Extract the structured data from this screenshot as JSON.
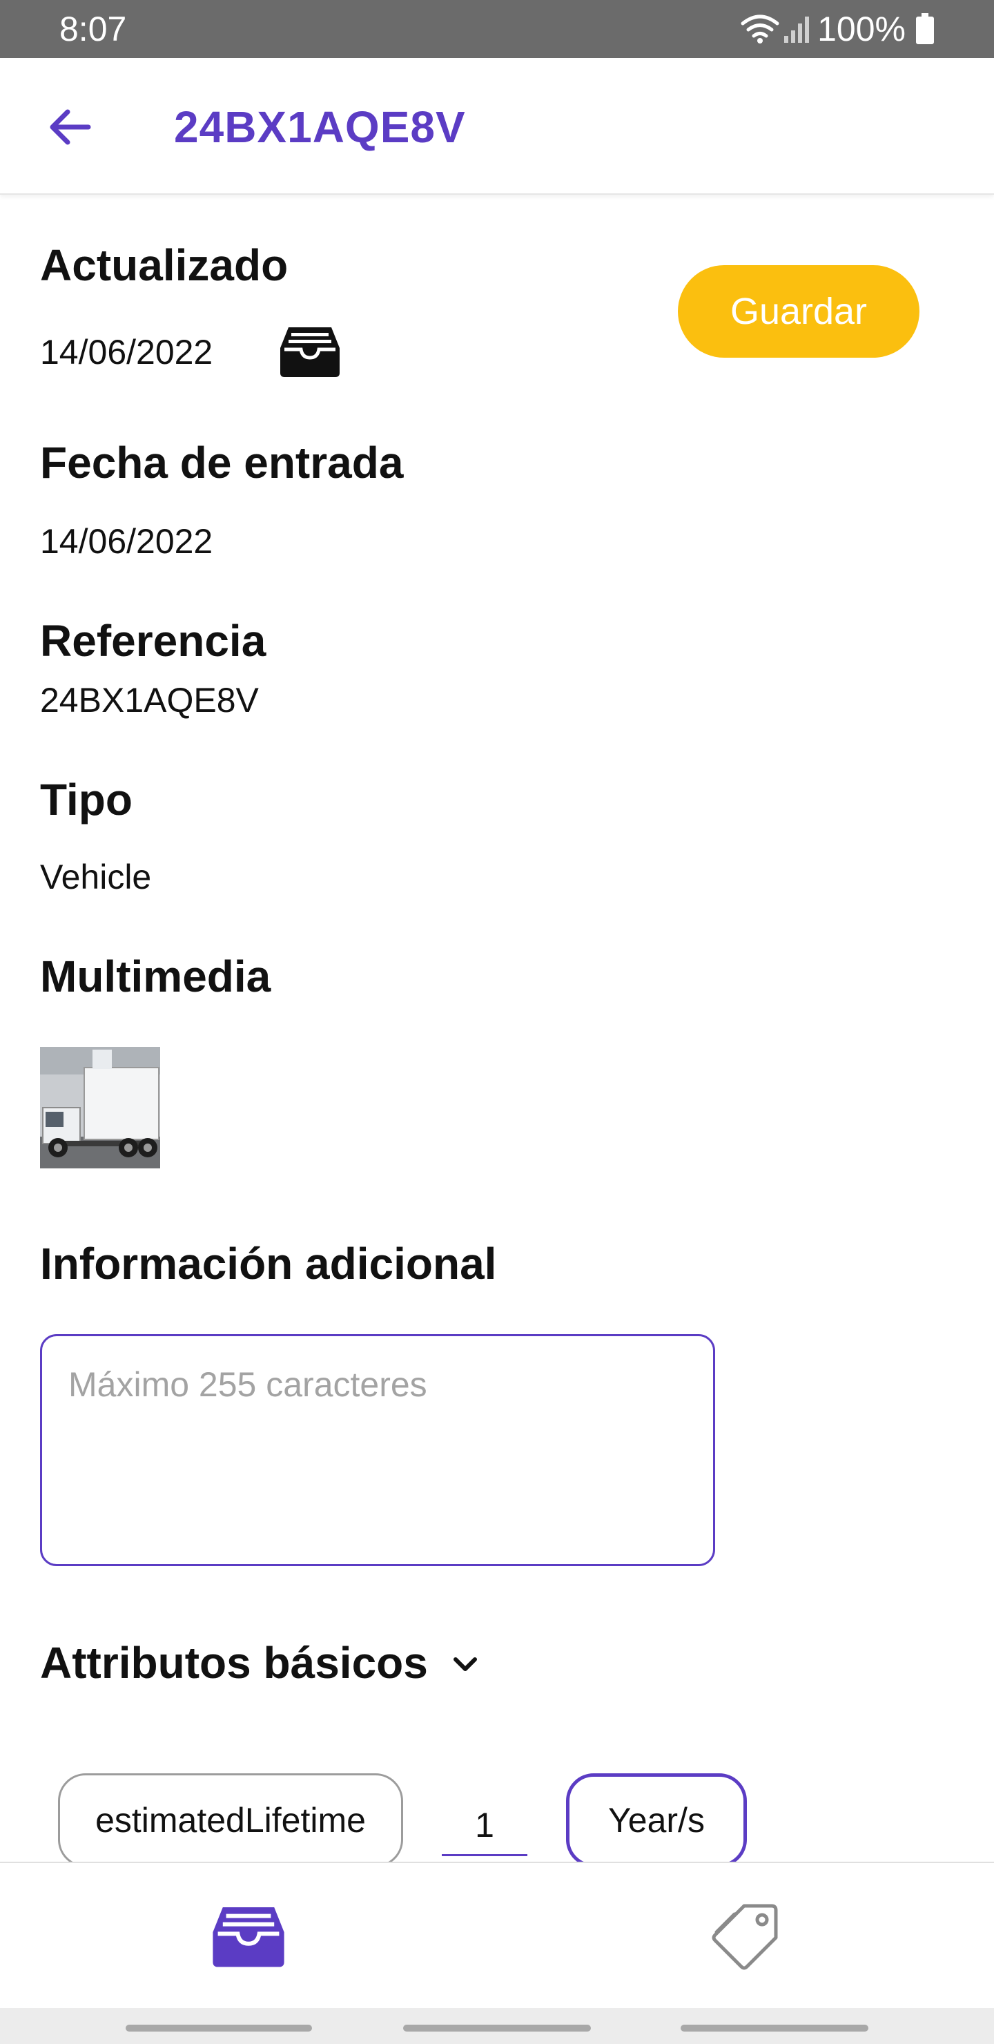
{
  "status_bar": {
    "time": "8:07",
    "battery": "100%",
    "icons": [
      "wifi-icon",
      "signal-icon",
      "battery-icon"
    ]
  },
  "app_bar": {
    "back_icon": "arrow-left-icon",
    "title": "24BX1AQE8V"
  },
  "actions": {
    "save_label": "Guardar"
  },
  "fields": {
    "updated_label": "Actualizado",
    "updated_value": "14/06/2022",
    "archive_icon": "archive-tray-icon",
    "entry_date_label": "Fecha de entrada",
    "entry_date_value": "14/06/2022",
    "reference_label": "Referencia",
    "reference_value": "24BX1AQE8V",
    "type_label": "Tipo",
    "type_value": "Vehicle",
    "media_label": "Multimedia",
    "additional_info_label": "Información adicional",
    "additional_info_placeholder": "Máximo 255 caracteres",
    "additional_info_value": ""
  },
  "attributes": {
    "heading": "Attributos básicos",
    "chevron_icon": "chevron-down-icon",
    "items": [
      {
        "name": "estimatedLifetime",
        "value": "1",
        "unit": "Year/s"
      }
    ]
  },
  "bottom_nav": {
    "items": [
      {
        "icon": "archive-tray-icon",
        "active": true
      },
      {
        "icon": "tag-icon",
        "active": false
      }
    ]
  },
  "colors": {
    "accent": "#5b3cc4",
    "save_button": "#fbbf0f",
    "status_bar": "#6b6b6b",
    "placeholder": "#a3a3a3"
  }
}
